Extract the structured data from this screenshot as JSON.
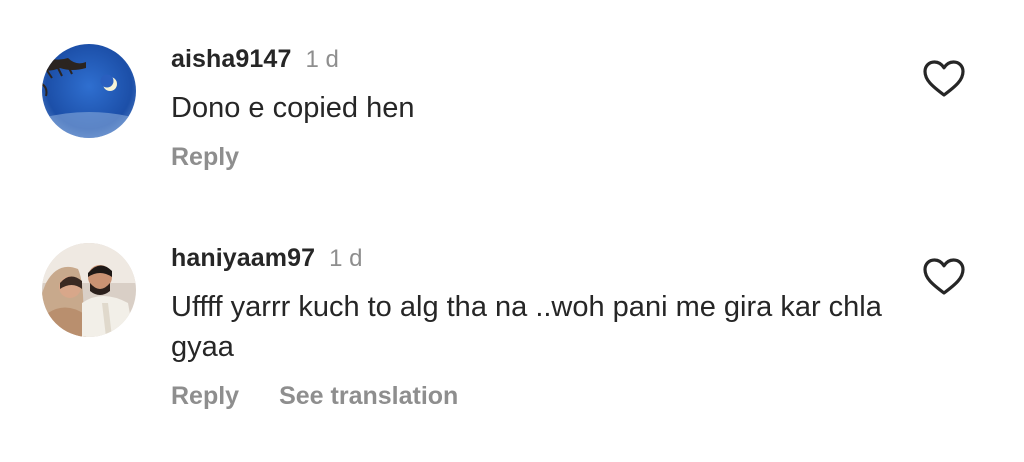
{
  "comments": [
    {
      "username": "aisha9147",
      "age": "1 d",
      "text": "Dono e copied hen",
      "reply_label": "Reply",
      "avatar_icon": "night-sky-moon-avatar",
      "like_icon": "heart-outline-icon"
    },
    {
      "username": "haniyaam97",
      "age": "1 d",
      "text": "Uffff yarrr kuch to alg tha na ..woh pani me gira kar chla gyaa",
      "reply_label": "Reply",
      "translate_label": "See translation",
      "avatar_icon": "couple-photo-avatar",
      "like_icon": "heart-outline-icon"
    }
  ],
  "colors": {
    "primary_text": "#262626",
    "secondary_text": "#8e8e8e",
    "background": "#ffffff"
  }
}
